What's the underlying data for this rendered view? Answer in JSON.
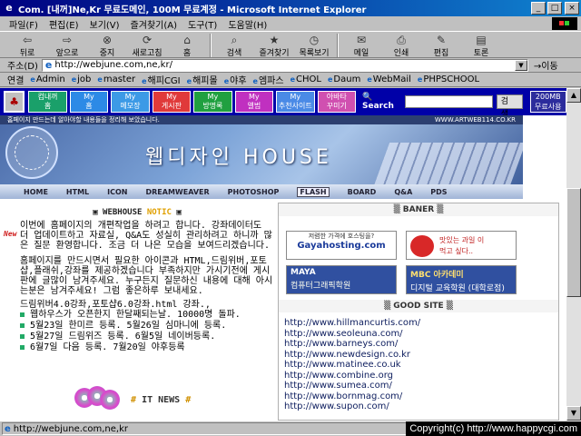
{
  "window": {
    "title": "Com. [내꺼]Ne,Kr 무료도메인, 100M 무료계정 - Microsoft Internet Explorer",
    "min": "_",
    "max": "□",
    "close": "×"
  },
  "menu": [
    "파일(F)",
    "편집(E)",
    "보기(V)",
    "즐겨찾기(A)",
    "도구(T)",
    "도움말(H)"
  ],
  "toolbar": {
    "back": "뒤로",
    "forward": "앞으로",
    "stop": "중지",
    "refresh": "새로고침",
    "home": "홈",
    "search": "검색",
    "favorites": "즐겨찾기",
    "history": "목록보기",
    "mail": "메일",
    "print": "인쇄",
    "edit": "편집",
    "discuss": "토론"
  },
  "address": {
    "label": "주소(D)",
    "value": "http://webjune.com,ne,kr/",
    "go": "이동"
  },
  "links": {
    "label": "연결",
    "items": [
      "Admin",
      "job",
      "master",
      "해피CGI",
      "해피몰",
      "야후",
      "엠파스",
      "CHOL",
      "Daum",
      "WebMail",
      "PHPSCHOOL"
    ]
  },
  "portal": {
    "tiles": [
      {
        "label": "컴내꺼\n홈",
        "color": "#1aa06a"
      },
      {
        "label": "My\n홈",
        "color": "#2c8ae6"
      },
      {
        "label": "My\n메모장",
        "color": "#3c9ae6"
      },
      {
        "label": "My\n게시판",
        "color": "#e03a3a"
      },
      {
        "label": "My\n방명록",
        "color": "#20a040"
      },
      {
        "label": "My\n앨범",
        "color": "#c030c0"
      },
      {
        "label": "My\n추천사이트",
        "color": "#4a8ae6"
      },
      {
        "label": "아바타\n꾸미기",
        "color": "#d050b0"
      }
    ],
    "search_label": "Search",
    "search_btn": "검 색",
    "storage": "200MB\n무료사용"
  },
  "banner": {
    "strip_text": "홈페이지 만드는데 알아야할 내용들을 정리해 보았습니다.",
    "strip_url": "WWW.ARTWEB114.CO.KR",
    "title": "웹디자인 HOUSE",
    "nav": [
      "HOME",
      "HTML",
      "ICON",
      "DREAMWEAVER",
      "PHOTOSHOP",
      "FLASH",
      "BOARD",
      "Q&A",
      "PDS"
    ]
  },
  "notice": {
    "heading_a": "▣ WEBHOUSE ",
    "heading_b": "NOTIC",
    "heading_c": " ▣",
    "new_tag": "New",
    "para1": "이번에 홈페이지의 개편작업을 하려고 합니다. 강좌데이터도 더 업데이트하고 자료실, Q&A도 성실히 관리하려고 하니까 많은 질문 환영합니다. 조금 더 나은 모습을 보여드리겠습니다.",
    "para2": "홈페이지를 만드시면서 필요한 아이콘과 HTML,드림위버,포토샵,플래쉬,강좌를 제공하겠습니다 부족하지만 가시기전에 게시판에 글많이 남겨주세요. 누구든지 질문하신 내용에 대해 아시는분은 남겨주세요! 그럼 좋은하루 보내세요.",
    "para3": "드림위버4.0강좌,포토샵6.0강좌.html 강좌.,",
    "bullets": [
      "웹하우스가 오픈한지 한달째되는날. 10000명 돌파.",
      "5월23일 한미르 등록. 5월26일 심마니에 등록.",
      "5월27일 드림위즈 등록. 6월5일 네이버등록.",
      "6월7일 다음 등록. 7월20일 야후등록"
    ],
    "itnews_hash": "#",
    "itnews_label": "IT NEWS",
    "itnews_end": "#"
  },
  "baner": {
    "heading": "▒ BANER ▒",
    "ad1_tag": "저렴한 가격에 호스팅을?",
    "ad1_big": "Gayahosting.com",
    "ad2_text": "맛있는 과일 이\n먹고 싶다..",
    "ad3_a": "MAYA",
    "ad3_b": "컴퓨터그래픽학원",
    "ad4_a": "MBC 아카데미",
    "ad4_b": "디지털 교육학원 (대학로점)"
  },
  "goodsite": {
    "heading": "▒ GOOD SITE ▒",
    "sites": [
      "http://www.hillmancurtis.com/",
      "http://www.seoleuna.com/",
      "http://www.barneys.com/",
      "http://www.newdesign.co.kr",
      "http://www.matinee.co.uk",
      "http://www.combine.org",
      "http://www.sumea.com/",
      "http://www.bornmag.com/",
      "http://www.supon.com/"
    ]
  },
  "status": {
    "url": "http://webjune.com,ne,kr",
    "copyright": "Copyright(c) http://www.happycgi.com"
  }
}
